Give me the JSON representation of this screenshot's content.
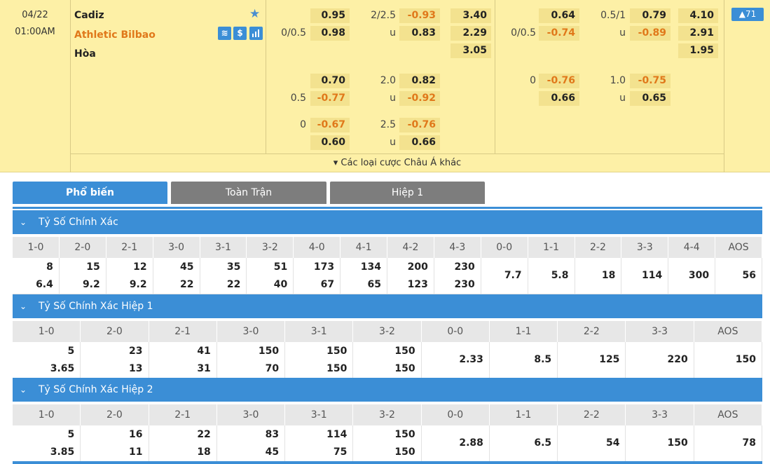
{
  "match": {
    "date": "04/22",
    "time": "01:00AM",
    "home": "Cadiz",
    "away": "Athletic Bilbao",
    "draw": "Hòa",
    "expand_count": "▲71",
    "more_label": "▾ Các loại cược Châu Á khác",
    "icons": [
      "money-stack-icon",
      "dollar-icon",
      "stats-bars-icon",
      "star-icon"
    ]
  },
  "odds": {
    "ft_handicap": [
      {
        "line": "",
        "home": "0.95",
        "away": "0.98",
        "away_line": "0/0.5"
      },
      {
        "line": "",
        "home": "0.70",
        "away": "-0.77",
        "away_line": "0.5"
      },
      {
        "line": "0",
        "home": "-0.67",
        "away": "0.60",
        "away_line": ""
      }
    ],
    "ft_overunder": [
      {
        "line": "2/2.5",
        "over": "-0.93",
        "under": "0.83",
        "u": "u"
      },
      {
        "line": "2.0",
        "over": "0.82",
        "under": "-0.92",
        "u": "u"
      },
      {
        "line": "2.5",
        "over": "-0.76",
        "under": "0.66",
        "u": "u"
      }
    ],
    "ft_1x2": [
      "3.40",
      "2.29",
      "3.05"
    ],
    "h1_handicap": [
      {
        "line": "",
        "home": "0.64",
        "away": "-0.74",
        "away_line": "0/0.5"
      },
      {
        "line": "0",
        "home": "-0.76",
        "away": "0.66",
        "away_line": ""
      }
    ],
    "h1_overunder": [
      {
        "line": "0.5/1",
        "over": "0.79",
        "under": "-0.89",
        "u": "u"
      },
      {
        "line": "1.0",
        "over": "-0.75",
        "under": "0.65",
        "u": "u"
      }
    ],
    "h1_1x2": [
      "4.10",
      "2.91",
      "1.95"
    ]
  },
  "tabs": [
    "Phổ biến",
    "Toàn Trận",
    "Hiệp 1"
  ],
  "sections": [
    {
      "title": "Tỷ Số Chính Xác",
      "headers": [
        "1-0",
        "2-0",
        "2-1",
        "3-0",
        "3-1",
        "3-2",
        "4-0",
        "4-1",
        "4-2",
        "4-3",
        "0-0",
        "1-1",
        "2-2",
        "3-3",
        "4-4",
        "AOS"
      ],
      "values": [
        [
          "8",
          "6.4"
        ],
        [
          "15",
          "9.2"
        ],
        [
          "12",
          "9.2"
        ],
        [
          "45",
          "22"
        ],
        [
          "35",
          "22"
        ],
        [
          "51",
          "40"
        ],
        [
          "173",
          "67"
        ],
        [
          "134",
          "65"
        ],
        [
          "200",
          "123"
        ],
        [
          "230",
          "230"
        ],
        [
          "7.7"
        ],
        [
          "5.8"
        ],
        [
          "18"
        ],
        [
          "114"
        ],
        [
          "300"
        ],
        [
          "56"
        ]
      ]
    },
    {
      "title": "Tỷ Số Chính Xác Hiệp 1",
      "headers": [
        "1-0",
        "2-0",
        "2-1",
        "3-0",
        "3-1",
        "3-2",
        "0-0",
        "1-1",
        "2-2",
        "3-3",
        "AOS"
      ],
      "values": [
        [
          "5",
          "3.65"
        ],
        [
          "23",
          "13"
        ],
        [
          "41",
          "31"
        ],
        [
          "150",
          "70"
        ],
        [
          "150",
          "150"
        ],
        [
          "150",
          "150"
        ],
        [
          "2.33"
        ],
        [
          "8.5"
        ],
        [
          "125"
        ],
        [
          "220"
        ],
        [
          "150"
        ]
      ]
    },
    {
      "title": "Tỷ Số Chính Xác Hiệp 2",
      "headers": [
        "1-0",
        "2-0",
        "2-1",
        "3-0",
        "3-1",
        "3-2",
        "0-0",
        "1-1",
        "2-2",
        "3-3",
        "AOS"
      ],
      "values": [
        [
          "5",
          "3.85"
        ],
        [
          "16",
          "11"
        ],
        [
          "22",
          "18"
        ],
        [
          "83",
          "45"
        ],
        [
          "114",
          "75"
        ],
        [
          "150",
          "150"
        ],
        [
          "2.88"
        ],
        [
          "6.5"
        ],
        [
          "54"
        ],
        [
          "150"
        ],
        [
          "78"
        ]
      ]
    }
  ]
}
